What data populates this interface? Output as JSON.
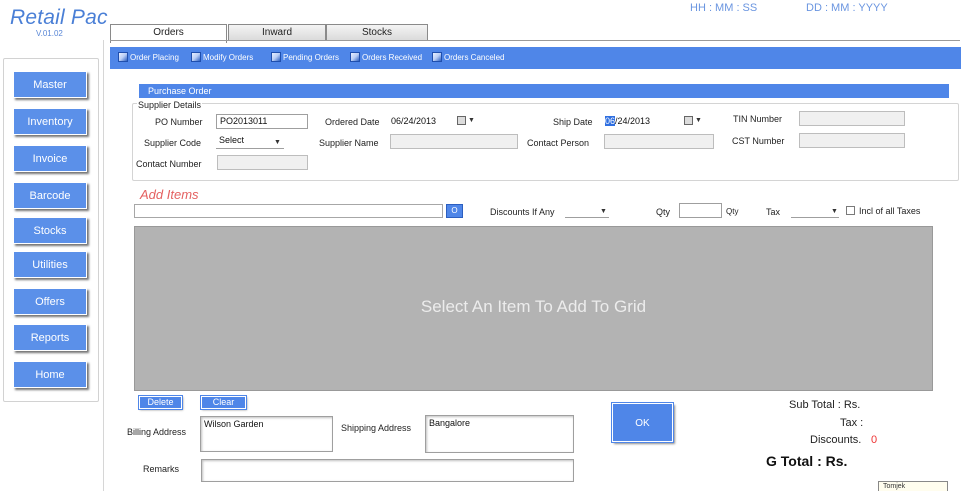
{
  "app": {
    "title": "Retail Pac",
    "version": "V.01.02"
  },
  "clock": {
    "time": "HH : MM : SS",
    "date": "DD : MM : YYYY"
  },
  "sidebar": {
    "items": [
      {
        "label": "Master"
      },
      {
        "label": "Inventory"
      },
      {
        "label": "Invoice"
      },
      {
        "label": "Barcode"
      },
      {
        "label": "Stocks"
      },
      {
        "label": "Utilities"
      },
      {
        "label": "Offers"
      },
      {
        "label": "Reports"
      },
      {
        "label": "Home"
      }
    ]
  },
  "tabs": [
    {
      "label": "Orders",
      "active": true
    },
    {
      "label": "Inward",
      "active": false
    },
    {
      "label": "Stocks",
      "active": false
    }
  ],
  "toolbar": {
    "items": [
      {
        "label": "Order Placing",
        "icon": "order-icon"
      },
      {
        "label": "Modify Orders",
        "icon": "order-icon"
      },
      {
        "label": "Pending Orders",
        "icon": "order-icon"
      },
      {
        "label": "Orders Received",
        "icon": "order-icon"
      },
      {
        "label": "Orders Canceled",
        "icon": "order-icon"
      }
    ]
  },
  "section": {
    "title": "Purchase Order"
  },
  "supplier": {
    "group_label": "Supplier Details",
    "po_number_label": "PO Number",
    "po_number_value": "PO2013011",
    "ordered_date_label": "Ordered Date",
    "ordered_date_value": "06/24/2013",
    "ship_date_label": "Ship Date",
    "ship_date_highlight": "06",
    "ship_date_rest": "/24/2013",
    "tin_label": "TIN Number",
    "tin_value": "",
    "supplier_code_label": "Supplier Code",
    "supplier_code_value": "Select",
    "supplier_name_label": "Supplier Name",
    "supplier_name_value": "",
    "contact_person_label": "Contact Person",
    "contact_person_value": "",
    "cst_label": "CST Number",
    "cst_value": "",
    "contact_number_label": "Contact Number",
    "contact_number_value": ""
  },
  "add_items": {
    "title": "Add Items",
    "search_button": "O",
    "discount_label": "Discounts If Any",
    "discount_value": "",
    "qty_label": "Qty",
    "qty_value": "",
    "qty_unit": "Qty",
    "tax_label": "Tax",
    "tax_value": "",
    "incl_taxes_label": "Incl of all Taxes",
    "incl_taxes_checked": false
  },
  "grid": {
    "empty_message": "Select An Item To Add To Grid"
  },
  "actions": {
    "delete_label": "Delete",
    "clear_label": "Clear",
    "ok_label": "OK"
  },
  "billing": {
    "label": "Billing Address",
    "value": "Wilson Garden"
  },
  "shipping": {
    "label": "Shipping Address",
    "value": "Bangalore"
  },
  "remarks": {
    "label": "Remarks",
    "value": ""
  },
  "totals": {
    "subtotal_label": "Sub Total : Rs.",
    "tax_label": "Tax :",
    "discounts_label": "Discounts.",
    "discounts_value": "0",
    "gtotal_label": "G Total : Rs."
  },
  "tooltip": {
    "text": "Tomjek"
  },
  "colors": {
    "accent": "#4f86e8",
    "grid": "#b3b3b3",
    "discount": "#e33333",
    "title": "#4a7fd6"
  }
}
